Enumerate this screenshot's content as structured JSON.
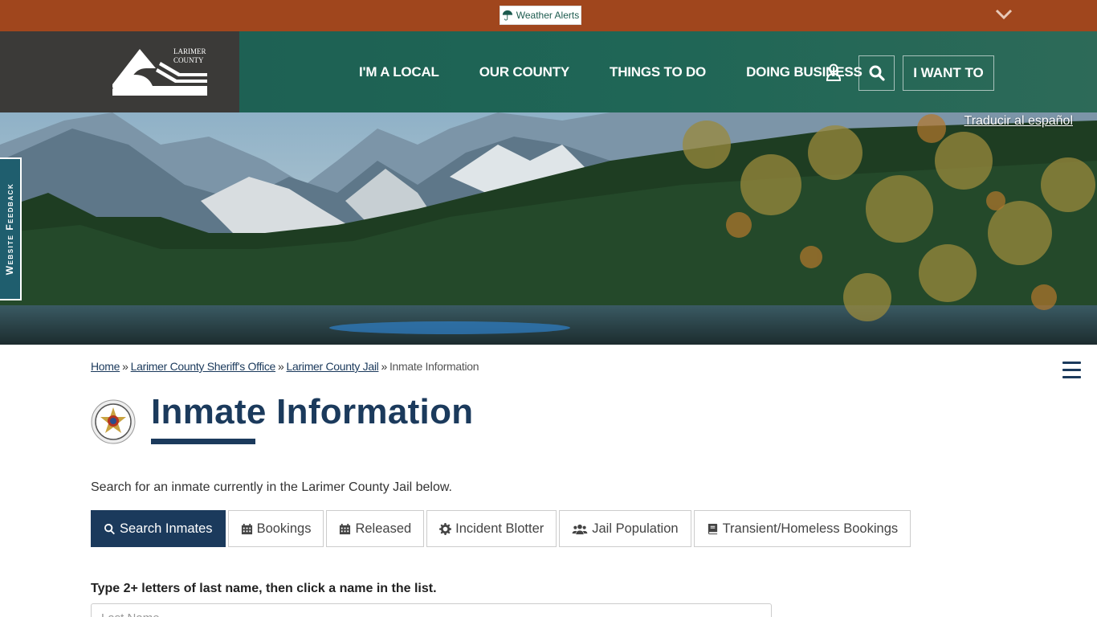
{
  "alert_bar": {
    "weather_label": "Weather Alerts",
    "icon": "umbrella-icon",
    "toggle_icon": "chevron-down-icon"
  },
  "header": {
    "logo_text_line1": "LARIMER",
    "logo_text_line2": "COUNTY",
    "nav": [
      "I'M A LOCAL",
      "OUR COUNTY",
      "THINGS TO DO",
      "DOING BUSINESS"
    ],
    "account_icon": "user-icon",
    "search_icon": "search-icon",
    "i_want_to": "I WANT TO"
  },
  "hero": {
    "translate_link": "Traducir al español"
  },
  "feedback_tab": "Website Feedback",
  "breadcrumb": {
    "items": [
      "Home",
      "Larimer County Sheriff's Office",
      "Larimer County Jail"
    ],
    "current": "Inmate Information",
    "separator": "»"
  },
  "page": {
    "title": "Inmate Information",
    "badge_icon": "sheriff-badge-icon",
    "intro": "Search for an inmate currently in the Larimer County Jail below."
  },
  "tabs": [
    {
      "label": "Search Inmates",
      "icon": "search-icon",
      "active": true
    },
    {
      "label": "Bookings",
      "icon": "calendar-icon",
      "active": false
    },
    {
      "label": "Released",
      "icon": "calendar-icon",
      "active": false
    },
    {
      "label": "Incident Blotter",
      "icon": "gear-icon",
      "active": false
    },
    {
      "label": "Jail Population",
      "icon": "users-icon",
      "active": false
    },
    {
      "label": "Transient/Homeless Bookings",
      "icon": "book-icon",
      "active": false
    }
  ],
  "search_form": {
    "label": "Type 2+ letters of last name, then click a name in the list.",
    "placeholder": "Last Name",
    "value": ""
  },
  "colors": {
    "alert_bar": "#a0461d",
    "header_green": "#1d5e52",
    "logo_box": "#3b3a38",
    "navy": "#1b3a5c",
    "feedback_tab": "#1f5e6e"
  }
}
